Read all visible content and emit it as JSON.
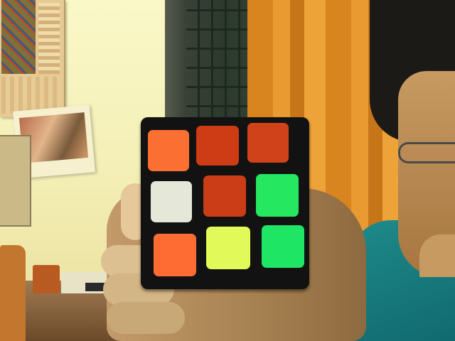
{
  "scene": {
    "cube_stickers": [
      {
        "name": "sticker-top-left",
        "color": "#fb6f32"
      },
      {
        "name": "sticker-top-middle",
        "color": "#cd3c15"
      },
      {
        "name": "sticker-top-right",
        "color": "#d0431a"
      },
      {
        "name": "sticker-middle-left",
        "color": "#e5e8d8"
      },
      {
        "name": "sticker-center",
        "color": "#cb3d17"
      },
      {
        "name": "sticker-middle-right",
        "color": "#25e860"
      },
      {
        "name": "sticker-bottom-left",
        "color": "#fe6b33"
      },
      {
        "name": "sticker-bottom-middle",
        "color": "#e2f95a"
      },
      {
        "name": "sticker-bottom-right",
        "color": "#1ee563"
      }
    ]
  }
}
